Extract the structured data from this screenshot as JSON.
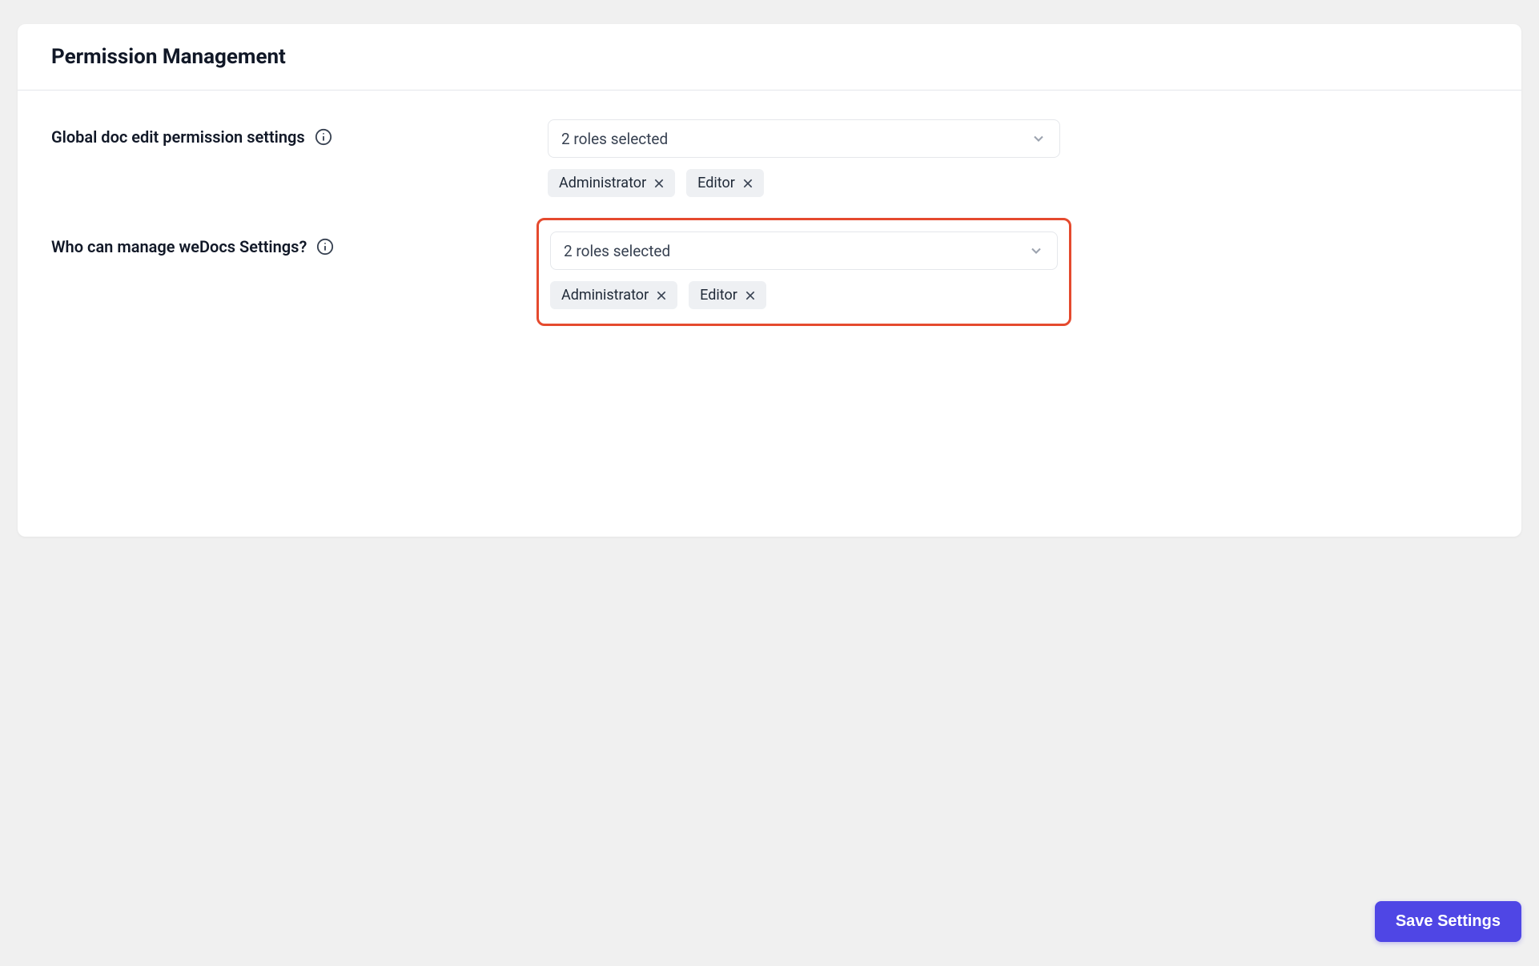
{
  "page": {
    "title": "Permission Management"
  },
  "settings": [
    {
      "label": "Global doc edit permission settings",
      "dropdown_text": "2 roles selected",
      "tags": [
        "Administrator",
        "Editor"
      ],
      "highlighted": false
    },
    {
      "label": "Who can manage weDocs Settings?",
      "dropdown_text": "2 roles selected",
      "tags": [
        "Administrator",
        "Editor"
      ],
      "highlighted": true
    }
  ],
  "actions": {
    "save_label": "Save Settings"
  }
}
